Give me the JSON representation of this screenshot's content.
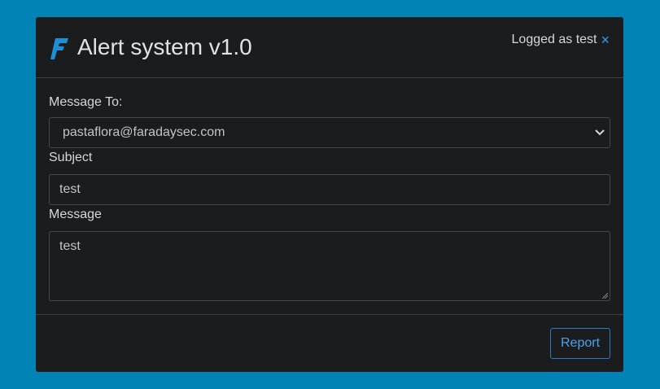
{
  "header": {
    "title": "Alert system v1.0",
    "login_status": "Logged as test",
    "close_glyph": "×",
    "logo_icon": "faraday-logo-icon",
    "accent_color": "#3b9de6"
  },
  "form": {
    "to_label": "Message To:",
    "to_value": "pastaflora@faradaysec.com",
    "subject_label": "Subject",
    "subject_value": "test",
    "message_label": "Message",
    "message_value": "test"
  },
  "footer": {
    "report_label": "Report"
  },
  "colors": {
    "page_background": "#0184b5",
    "modal_background": "#1b1c1e",
    "button_accent": "#4aa2ee"
  }
}
